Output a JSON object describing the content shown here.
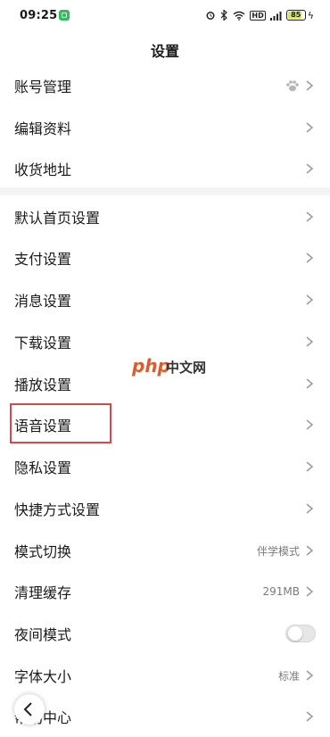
{
  "status_bar": {
    "time": "09:25",
    "hd_label": "HD",
    "battery_level": "85",
    "battery_fill_fraction": 0.85,
    "battery_color": "#d8e84a"
  },
  "header": {
    "title": "设置"
  },
  "sections": [
    {
      "items": [
        {
          "label": "账号管理",
          "value": "",
          "accessory": "paw-icon"
        },
        {
          "label": "编辑资料",
          "value": ""
        },
        {
          "label": "收货地址",
          "value": ""
        }
      ]
    },
    {
      "items": [
        {
          "label": "默认首页设置",
          "value": ""
        },
        {
          "label": "支付设置",
          "value": ""
        },
        {
          "label": "消息设置",
          "value": ""
        },
        {
          "label": "下载设置",
          "value": ""
        },
        {
          "label": "播放设置",
          "value": ""
        },
        {
          "label": "语音设置",
          "value": "",
          "highlighted": true
        },
        {
          "label": "隐私设置",
          "value": ""
        },
        {
          "label": "快捷方式设置",
          "value": ""
        },
        {
          "label": "模式切换",
          "value": "伴学模式"
        },
        {
          "label": "清理缓存",
          "value": "291MB"
        },
        {
          "label": "夜间模式",
          "value": "",
          "toggle": false
        },
        {
          "label": "字体大小",
          "value": "标准"
        },
        {
          "label": "帮助中心",
          "value": ""
        }
      ]
    }
  ],
  "watermark": {
    "php": "php",
    "cn": "中文网"
  },
  "colors": {
    "highlight_border": "#d24b4b",
    "divider": "#f4f4f4",
    "secondary_text": "#7a7a7a"
  }
}
